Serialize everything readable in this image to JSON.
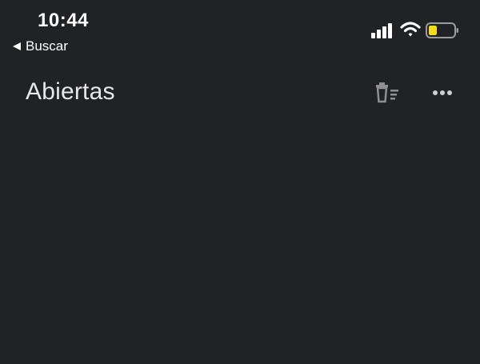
{
  "status_bar": {
    "time": "10:44",
    "back_label": "Buscar",
    "battery_color": "#f5dc1a",
    "icons": [
      "cellular-signal-icon",
      "wifi-icon",
      "battery-icon"
    ]
  },
  "header": {
    "title": "Abiertas",
    "actions": [
      "delete-tabs-icon",
      "more-options-icon"
    ]
  },
  "colors": {
    "background": "#212226",
    "text": "#ffffff",
    "icon_muted": "#8e8e93"
  }
}
